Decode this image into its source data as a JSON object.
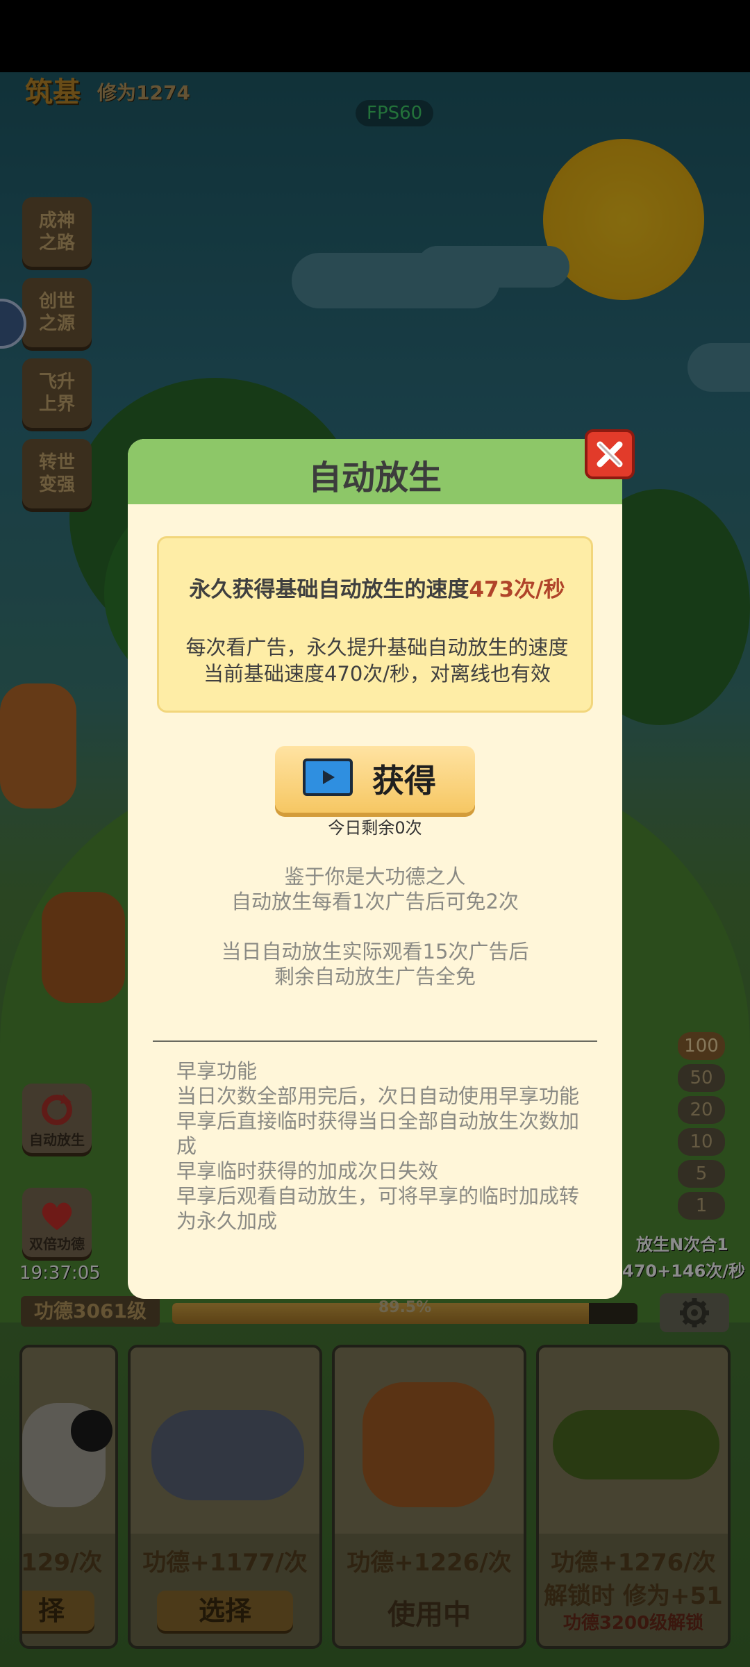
{
  "hud": {
    "realm": "筑基",
    "cultivation": "修为1274",
    "fps": "FPS60",
    "side_buttons": [
      "成神\n之路",
      "创世\n之源",
      "飞升\n上界",
      "转世\n变强"
    ],
    "auto_release": "自动放生",
    "double_merit": "双倍功德",
    "clock": "19:37:05",
    "multipliers": [
      "100",
      "50",
      "20",
      "10",
      "5",
      "1"
    ],
    "release_n": "放生N次合1",
    "rate": "470+146次/秒",
    "merit_level": "功德3061级",
    "progress_text": "89.5%",
    "progress_value": 0.895
  },
  "cards": [
    {
      "merit": "129/次",
      "action": "择"
    },
    {
      "merit": "功德+1177/次",
      "action": "选择"
    },
    {
      "merit": "功德+1226/次",
      "action": "使用中"
    },
    {
      "merit": "功德+1276/次",
      "merit2": "解锁时 修为+51",
      "unlock": "功德3200级解锁"
    }
  ],
  "modal": {
    "title": "自动放生",
    "info_prefix": "永久获得基础自动放生的速度",
    "info_highlight": "473次/秒",
    "info_desc1": "每次看广告，永久提升基础自动放生的速度",
    "info_desc2": "当前基础速度470次/秒，对离线也有效",
    "get_label": "获得",
    "remain": "今日剩余0次",
    "note1a": "鉴于你是大功德之人",
    "note1b": "自动放生每看1次广告后可免2次",
    "note2a": "当日自动放生实际观看15次广告后",
    "note2b": "剩余自动放生广告全免",
    "early": [
      "早享功能",
      "当日次数全部用完后，次日自动使用早享功能",
      "早享后直接临时获得当日全部自动放生次数加成",
      "早享临时获得的加成次日失效",
      "早享后观看自动放生，可将早享的临时加成转为永久加成"
    ]
  },
  "colors": {
    "modal_bg": "#fff6d9",
    "modal_header": "#8dc768",
    "highlight": "#b0442a",
    "close": "#e23b2a"
  }
}
